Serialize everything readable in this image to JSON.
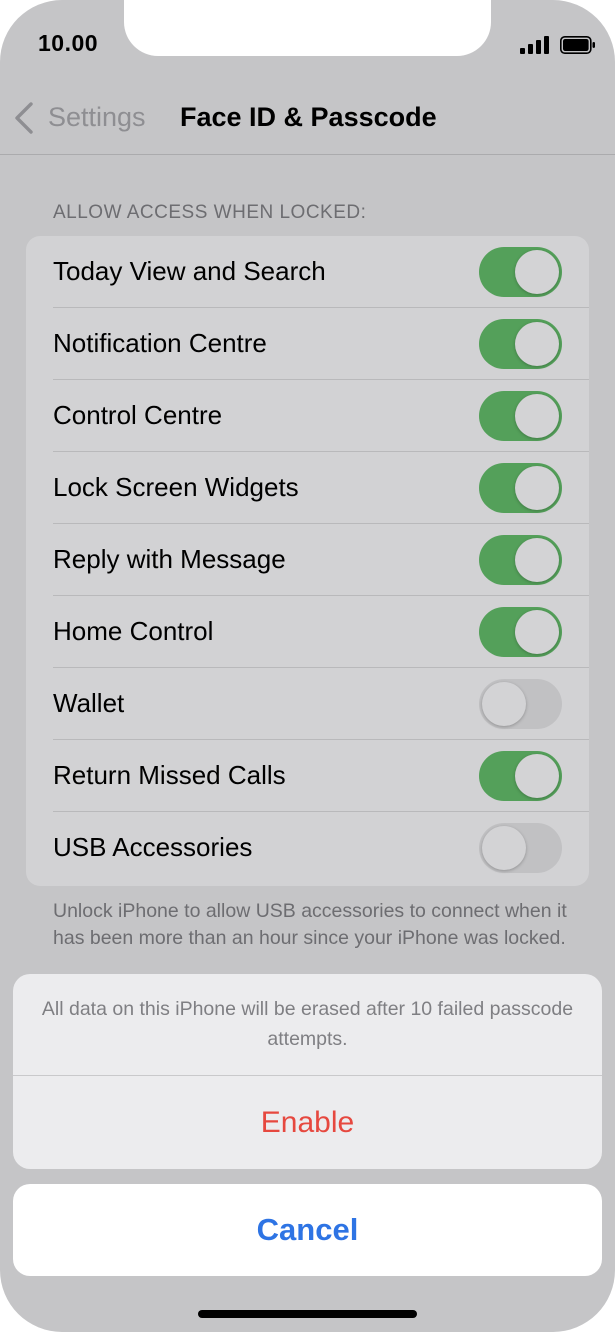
{
  "status_bar": {
    "time": "10.00"
  },
  "nav": {
    "back_label": "Settings",
    "title": "Face ID & Passcode"
  },
  "section": {
    "header": "ALLOW ACCESS WHEN LOCKED:",
    "items": [
      {
        "label": "Today View and Search",
        "on": true
      },
      {
        "label": "Notification Centre",
        "on": true
      },
      {
        "label": "Control Centre",
        "on": true
      },
      {
        "label": "Lock Screen Widgets",
        "on": true
      },
      {
        "label": "Reply with Message",
        "on": true
      },
      {
        "label": "Home Control",
        "on": true
      },
      {
        "label": "Wallet",
        "on": false
      },
      {
        "label": "Return Missed Calls",
        "on": true
      },
      {
        "label": "USB Accessories",
        "on": false
      }
    ],
    "footnote": "Unlock iPhone to allow USB accessories to connect when it has been more than an hour since your iPhone was locked."
  },
  "action_sheet": {
    "message": "All data on this iPhone will be erased after 10 failed passcode attempts.",
    "enable_label": "Enable",
    "cancel_label": "Cancel"
  },
  "colors": {
    "toggle_on": "#54a05a",
    "toggle_off": "#c1c1c3",
    "destructive": "#e6483f",
    "accent": "#2e74e4"
  }
}
